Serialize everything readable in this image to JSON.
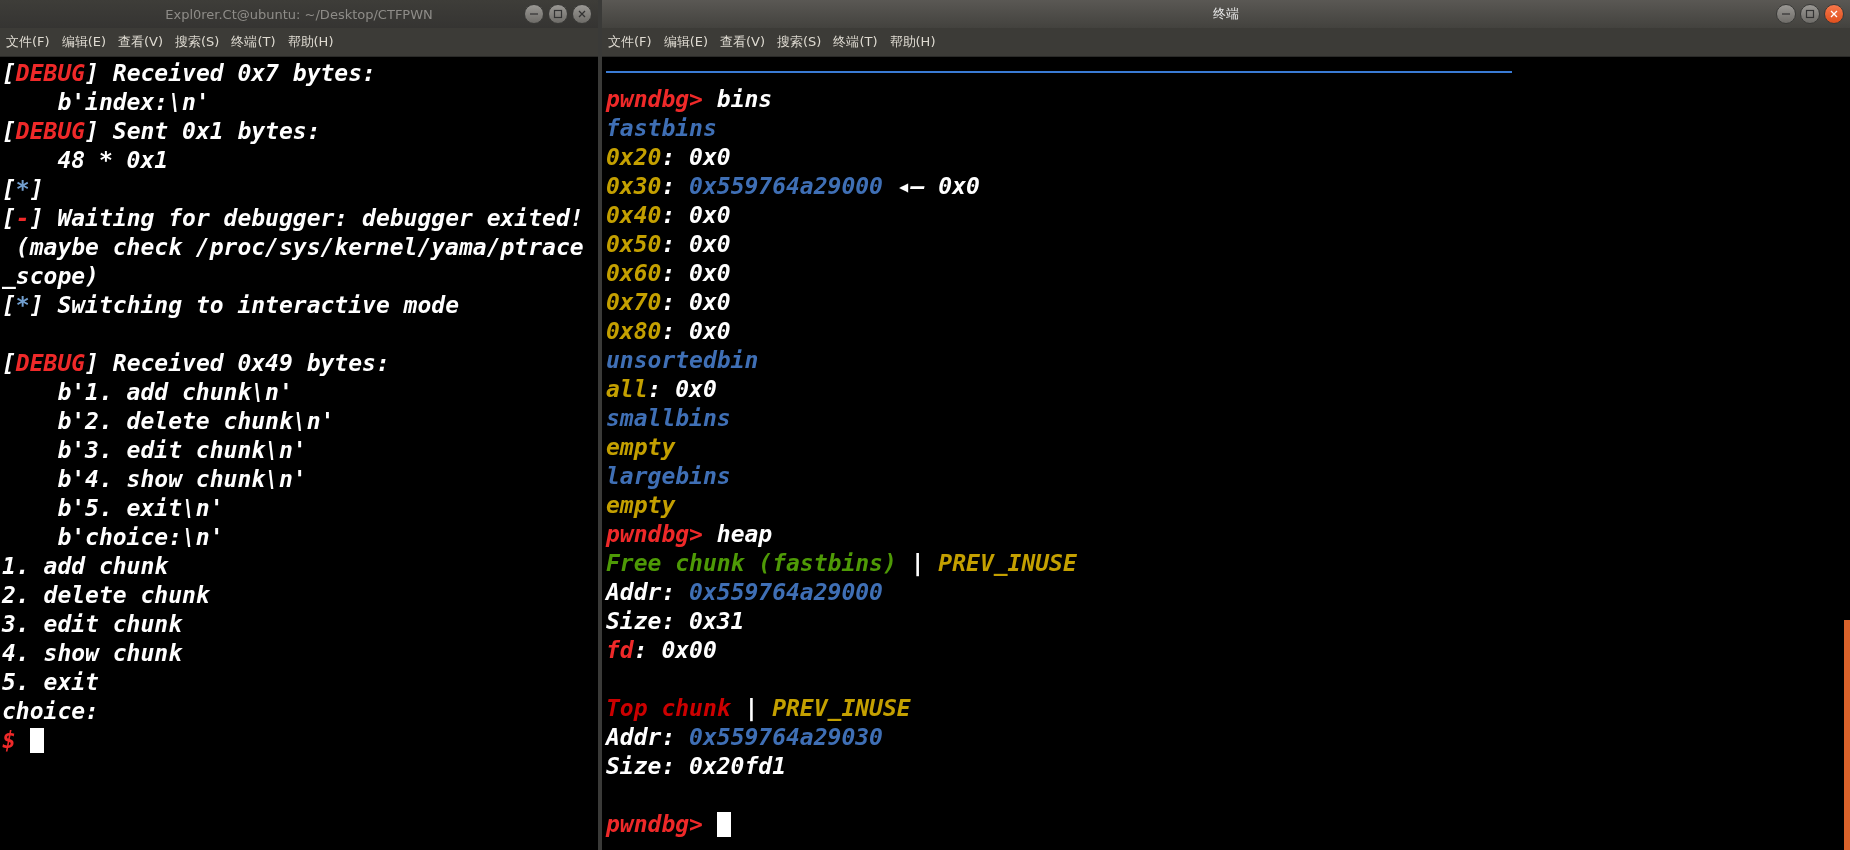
{
  "windows": [
    {
      "title": "Expl0rer.Ct@ubuntu: ~/Desktop/CTFPWN",
      "active": false,
      "menu": [
        "文件(F)",
        "编辑(E)",
        "查看(V)",
        "搜索(S)",
        "终端(T)",
        "帮助(H)"
      ],
      "lines": [
        {
          "kind": "text",
          "segments": [
            {
              "text": "[",
              "color": "#ffffff"
            },
            {
              "text": "DEBUG",
              "color": "#ef2929"
            },
            {
              "text": "] Received 0x7 bytes:",
              "color": "#ffffff"
            }
          ]
        },
        {
          "kind": "text",
          "segments": [
            {
              "text": "    b'index:\\n'",
              "color": "#ffffff"
            }
          ]
        },
        {
          "kind": "text",
          "segments": [
            {
              "text": "[",
              "color": "#ffffff"
            },
            {
              "text": "DEBUG",
              "color": "#ef2929"
            },
            {
              "text": "] Sent 0x1 bytes:",
              "color": "#ffffff"
            }
          ]
        },
        {
          "kind": "text",
          "segments": [
            {
              "text": "    48 * 0x1",
              "color": "#ffffff"
            }
          ]
        },
        {
          "kind": "text",
          "segments": [
            {
              "text": "[",
              "color": "#ffffff"
            },
            {
              "text": "*",
              "color": "#729fcf"
            },
            {
              "text": "]",
              "color": "#ffffff"
            }
          ]
        },
        {
          "kind": "text",
          "segments": [
            {
              "text": "[",
              "color": "#ffffff"
            },
            {
              "text": "-",
              "color": "#ef2929"
            },
            {
              "text": "] Waiting for debugger: debugger exited!",
              "color": "#ffffff"
            }
          ]
        },
        {
          "kind": "text",
          "segments": [
            {
              "text": " (maybe check /proc/sys/kernel/yama/ptrace",
              "color": "#ffffff"
            }
          ]
        },
        {
          "kind": "text",
          "segments": [
            {
              "text": "_scope)",
              "color": "#ffffff"
            }
          ]
        },
        {
          "kind": "text",
          "segments": [
            {
              "text": "[",
              "color": "#ffffff"
            },
            {
              "text": "*",
              "color": "#729fcf"
            },
            {
              "text": "] Switching to interactive mode",
              "color": "#ffffff"
            }
          ]
        },
        {
          "kind": "gap"
        },
        {
          "kind": "text",
          "segments": [
            {
              "text": "[",
              "color": "#ffffff"
            },
            {
              "text": "DEBUG",
              "color": "#ef2929"
            },
            {
              "text": "] Received 0x49 bytes:",
              "color": "#ffffff"
            }
          ]
        },
        {
          "kind": "text",
          "segments": [
            {
              "text": "    b'1. add chunk\\n'",
              "color": "#ffffff"
            }
          ]
        },
        {
          "kind": "text",
          "segments": [
            {
              "text": "    b'2. delete chunk\\n'",
              "color": "#ffffff"
            }
          ]
        },
        {
          "kind": "text",
          "segments": [
            {
              "text": "    b'3. edit chunk\\n'",
              "color": "#ffffff"
            }
          ]
        },
        {
          "kind": "text",
          "segments": [
            {
              "text": "    b'4. show chunk\\n'",
              "color": "#ffffff"
            }
          ]
        },
        {
          "kind": "text",
          "segments": [
            {
              "text": "    b'5. exit\\n'",
              "color": "#ffffff"
            }
          ]
        },
        {
          "kind": "text",
          "segments": [
            {
              "text": "    b'choice:\\n'",
              "color": "#ffffff"
            }
          ]
        },
        {
          "kind": "text",
          "segments": [
            {
              "text": "1. add chunk",
              "color": "#ffffff"
            }
          ]
        },
        {
          "kind": "text",
          "segments": [
            {
              "text": "2. delete chunk",
              "color": "#ffffff"
            }
          ]
        },
        {
          "kind": "text",
          "segments": [
            {
              "text": "3. edit chunk",
              "color": "#ffffff"
            }
          ]
        },
        {
          "kind": "text",
          "segments": [
            {
              "text": "4. show chunk",
              "color": "#ffffff"
            }
          ]
        },
        {
          "kind": "text",
          "segments": [
            {
              "text": "5. exit",
              "color": "#ffffff"
            }
          ]
        },
        {
          "kind": "text",
          "segments": [
            {
              "text": "choice:",
              "color": "#ffffff"
            }
          ]
        },
        {
          "kind": "prompt",
          "segments": [
            {
              "text": "$",
              "color": "#ef2929"
            }
          ]
        }
      ]
    },
    {
      "title": "终端",
      "active": true,
      "menu": [
        "文件(F)",
        "编辑(E)",
        "查看(V)",
        "搜索(S)",
        "终端(T)",
        "帮助(H)"
      ],
      "lines": [
        {
          "kind": "rule"
        },
        {
          "kind": "text",
          "segments": [
            {
              "text": "pwndbg>",
              "color": "#ef2929"
            },
            {
              "text": " bins",
              "color": "#ffffff"
            }
          ]
        },
        {
          "kind": "text",
          "segments": [
            {
              "text": "fastbins",
              "color": "#3f6fb5"
            }
          ]
        },
        {
          "kind": "text",
          "segments": [
            {
              "text": "0x20",
              "color": "#c4a000"
            },
            {
              "text": ": 0x0",
              "color": "#ffffff"
            }
          ]
        },
        {
          "kind": "text",
          "segments": [
            {
              "text": "0x30",
              "color": "#c4a000"
            },
            {
              "text": ": ",
              "color": "#ffffff"
            },
            {
              "text": "0x559764a29000",
              "color": "#3f6fb5"
            },
            {
              "text": " ◂— 0x0",
              "color": "#ffffff"
            }
          ]
        },
        {
          "kind": "text",
          "segments": [
            {
              "text": "0x40",
              "color": "#c4a000"
            },
            {
              "text": ": 0x0",
              "color": "#ffffff"
            }
          ]
        },
        {
          "kind": "text",
          "segments": [
            {
              "text": "0x50",
              "color": "#c4a000"
            },
            {
              "text": ": 0x0",
              "color": "#ffffff"
            }
          ]
        },
        {
          "kind": "text",
          "segments": [
            {
              "text": "0x60",
              "color": "#c4a000"
            },
            {
              "text": ": 0x0",
              "color": "#ffffff"
            }
          ]
        },
        {
          "kind": "text",
          "segments": [
            {
              "text": "0x70",
              "color": "#c4a000"
            },
            {
              "text": ": 0x0",
              "color": "#ffffff"
            }
          ]
        },
        {
          "kind": "text",
          "segments": [
            {
              "text": "0x80",
              "color": "#c4a000"
            },
            {
              "text": ": 0x0",
              "color": "#ffffff"
            }
          ]
        },
        {
          "kind": "text",
          "segments": [
            {
              "text": "unsortedbin",
              "color": "#3f6fb5"
            }
          ]
        },
        {
          "kind": "text",
          "segments": [
            {
              "text": "all",
              "color": "#c4a000"
            },
            {
              "text": ": 0x0",
              "color": "#ffffff"
            }
          ]
        },
        {
          "kind": "text",
          "segments": [
            {
              "text": "smallbins",
              "color": "#3f6fb5"
            }
          ]
        },
        {
          "kind": "text",
          "segments": [
            {
              "text": "empty",
              "color": "#c4a000"
            }
          ]
        },
        {
          "kind": "text",
          "segments": [
            {
              "text": "largebins",
              "color": "#3f6fb5"
            }
          ]
        },
        {
          "kind": "text",
          "segments": [
            {
              "text": "empty",
              "color": "#c4a000"
            }
          ]
        },
        {
          "kind": "text",
          "segments": [
            {
              "text": "pwndbg>",
              "color": "#ef2929"
            },
            {
              "text": " heap",
              "color": "#ffffff"
            }
          ]
        },
        {
          "kind": "text",
          "segments": [
            {
              "text": "Free chunk (fastbins)",
              "color": "#4e9a06"
            },
            {
              "text": " | ",
              "color": "#ffffff"
            },
            {
              "text": "PREV_INUSE",
              "color": "#c4a000"
            }
          ]
        },
        {
          "kind": "text",
          "segments": [
            {
              "text": "Addr: ",
              "color": "#ffffff"
            },
            {
              "text": "0x559764a29000",
              "color": "#3f6fb5"
            }
          ]
        },
        {
          "kind": "text",
          "segments": [
            {
              "text": "Size: 0x31",
              "color": "#ffffff"
            }
          ]
        },
        {
          "kind": "text",
          "segments": [
            {
              "text": "fd",
              "color": "#ef2929"
            },
            {
              "text": ": 0x00",
              "color": "#ffffff"
            }
          ]
        },
        {
          "kind": "gap"
        },
        {
          "kind": "text",
          "segments": [
            {
              "text": "Top chunk",
              "color": "#cc0000"
            },
            {
              "text": " | ",
              "color": "#ffffff"
            },
            {
              "text": "PREV_INUSE",
              "color": "#c4a000"
            }
          ]
        },
        {
          "kind": "text",
          "segments": [
            {
              "text": "Addr: ",
              "color": "#ffffff"
            },
            {
              "text": "0x559764a29030",
              "color": "#3f6fb5"
            }
          ]
        },
        {
          "kind": "text",
          "segments": [
            {
              "text": "Size: 0x20fd1",
              "color": "#ffffff"
            }
          ]
        },
        {
          "kind": "gap"
        },
        {
          "kind": "prompt",
          "segments": [
            {
              "text": "pwndbg>",
              "color": "#ef2929"
            }
          ]
        }
      ]
    }
  ]
}
